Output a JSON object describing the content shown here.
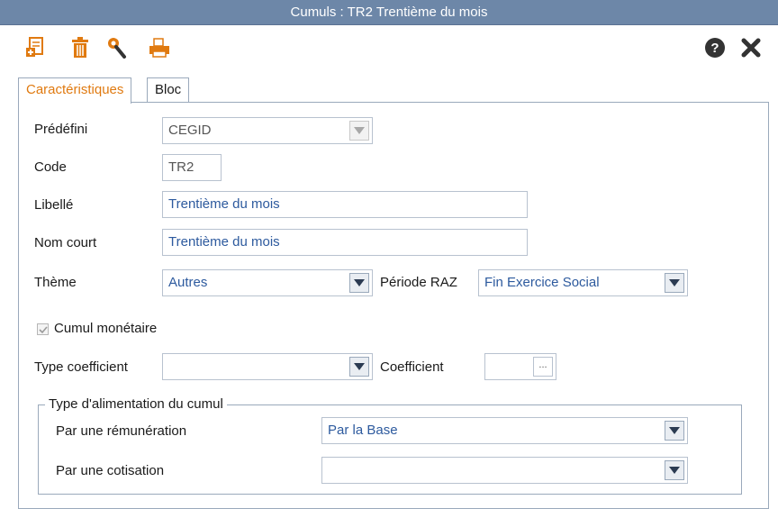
{
  "window": {
    "title": "Cumuls  : TR2 Trentième du mois"
  },
  "toolbar": {
    "icons": [
      "new-document-icon",
      "trash-icon",
      "wrench-icon",
      "print-icon",
      "help-icon",
      "close-icon"
    ],
    "colors": {
      "orange": "#e07a10",
      "red": "#c0392b",
      "dark": "#333333"
    }
  },
  "tabs": [
    {
      "label": "Caractéristiques",
      "active": true
    },
    {
      "label": "Bloc note",
      "active": false
    }
  ],
  "form": {
    "predefini": {
      "label": "Prédéfini",
      "value": "CEGID"
    },
    "code": {
      "label": "Code",
      "value": "TR2"
    },
    "libelle": {
      "label": "Libellé",
      "value": "Trentième du mois"
    },
    "nom_court": {
      "label": "Nom court",
      "value": "Trentième du mois"
    },
    "theme": {
      "label": "Thème",
      "value": "Autres"
    },
    "periode_raz": {
      "label": "Période RAZ",
      "value": "Fin Exercice Social"
    },
    "cumul_monetaire": {
      "label": "Cumul monétaire",
      "checked": true
    },
    "type_coefficient": {
      "label": "Type coefficient",
      "value": ""
    },
    "coefficient": {
      "label": "Coefficient",
      "value": "",
      "button": "..."
    }
  },
  "group": {
    "title": "Type d'alimentation du cumul",
    "remuneration": {
      "label": "Par une rémunération",
      "value": "Par la Base"
    },
    "cotisation": {
      "label": "Par une cotisation",
      "value": ""
    }
  }
}
